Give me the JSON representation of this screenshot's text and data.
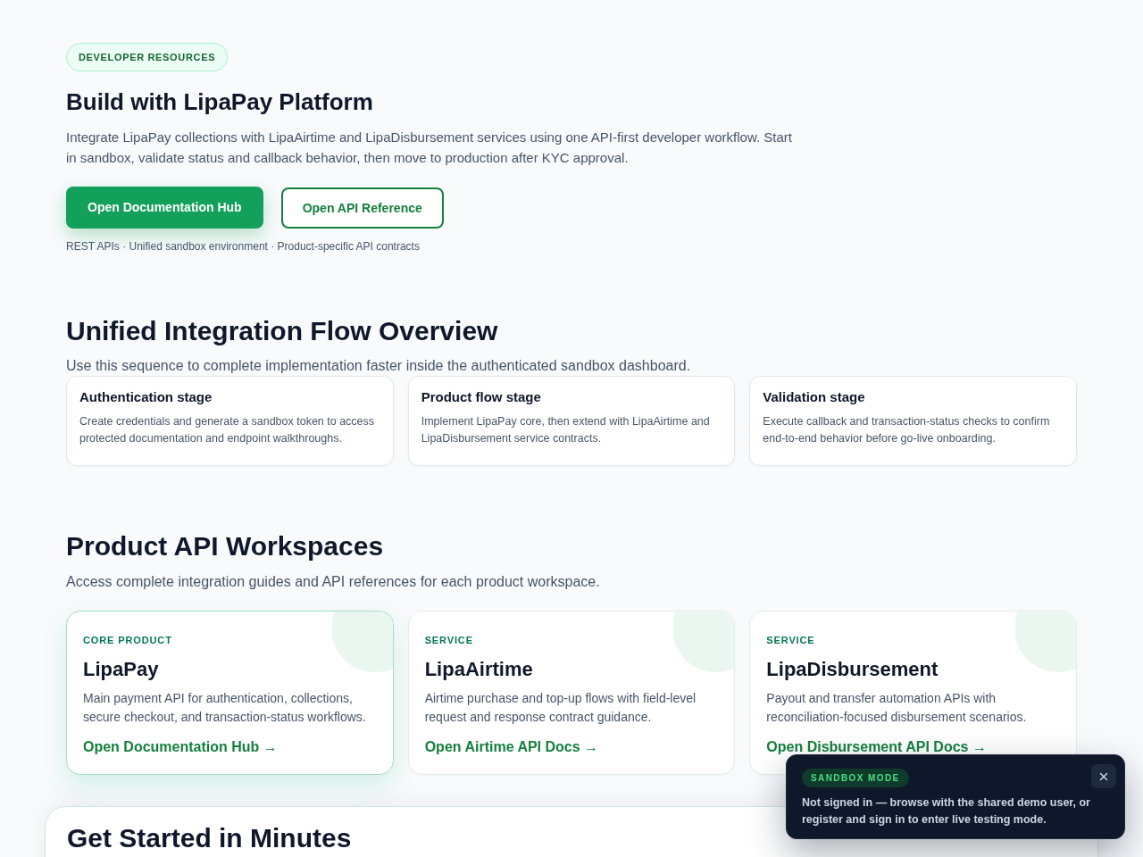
{
  "hero": {
    "badge": "DEVELOPER RESOURCES",
    "title": "Build with LipaPay Platform",
    "description": "Integrate LipaPay collections with LipaAirtime and LipaDisbursement services using one API-first developer workflow. Start in sandbox, validate status and callback behavior, then move to production after KYC approval.",
    "buttons": [
      {
        "label": "Open Documentation Hub",
        "kind": "primary"
      },
      {
        "label": "Open API Reference",
        "kind": "secondary"
      }
    ],
    "meta": "REST APIs · Unified sandbox environment · Product-specific API contracts"
  },
  "flow_overview": {
    "title": "Unified Integration Flow Overview",
    "subtitle": "Use this sequence to complete implementation faster inside the authenticated sandbox dashboard.",
    "stages": [
      {
        "title": "Authentication stage",
        "description": "Create credentials and generate a sandbox token to access protected documentation and endpoint walkthroughs."
      },
      {
        "title": "Product flow stage",
        "description": "Implement LipaPay core, then extend with LipaAirtime and LipaDisbursement service contracts."
      },
      {
        "title": "Validation stage",
        "description": "Execute callback and transaction-status checks to confirm end-to-end behavior before go-live onboarding."
      }
    ]
  },
  "workspaces": {
    "title": "Product API Workspaces",
    "subtitle": "Access complete integration guides and API references for each product workspace.",
    "products": [
      {
        "eyebrow": "CORE PRODUCT",
        "name": "LipaPay",
        "description": "Main payment API for authentication, collections, secure checkout, and transaction-status workflows.",
        "link": "Open Documentation Hub →",
        "selected": true
      },
      {
        "eyebrow": "SERVICE",
        "name": "LipaAirtime",
        "description": "Airtime purchase and top-up flows with field-level request and response contract guidance.",
        "link": "Open Airtime API Docs →",
        "selected": false
      },
      {
        "eyebrow": "SERVICE",
        "name": "LipaDisbursement",
        "description": "Payout and transfer automation APIs with reconciliation-focused disbursement scenarios.",
        "link": "Open Disbursement API Docs →",
        "selected": false
      }
    ]
  },
  "get_started": {
    "title": "Get Started in Minutes"
  },
  "toast": {
    "badge": "SANDBOX MODE",
    "message": "Not signed in — browse with the shared demo user, or register and sign in to enter live testing mode."
  }
}
